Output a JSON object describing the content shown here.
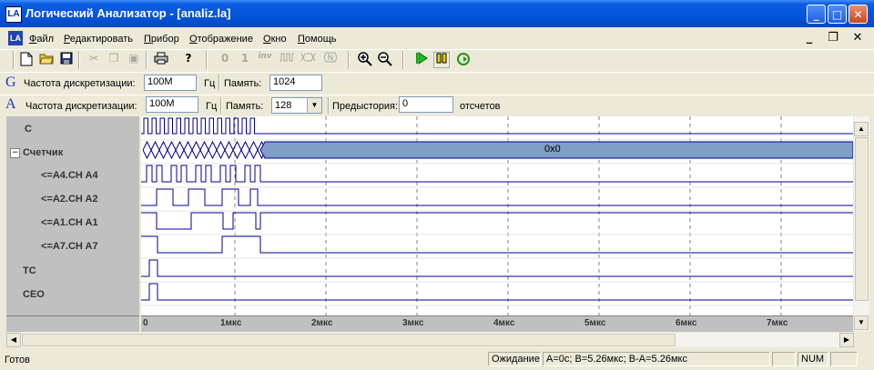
{
  "window": {
    "app_icon_text": "LA",
    "title": "Логический Анализатор - [analiz.la]",
    "minimize": "_",
    "maximize": "□",
    "close": "✕"
  },
  "menu": {
    "items": [
      "Файл",
      "Редактировать",
      "Прибор",
      "Отображение",
      "Окно",
      "Помощь"
    ],
    "mdi_minimize": "_",
    "mdi_restore": "❐",
    "mdi_close": "✕"
  },
  "toolbar": {
    "icons": [
      "new-document-icon",
      "open-folder-icon",
      "save-icon",
      "cut-icon",
      "copy-icon",
      "paste-icon",
      "print-icon",
      "help-icon",
      "zero-icon",
      "one-icon",
      "inv-icon",
      "clock-icon",
      "bus-icon",
      "number-icon",
      "zoom-in-icon",
      "zoom-out-icon",
      "run-icon",
      "pause-icon",
      "repeat-icon"
    ],
    "zero_label": "0",
    "one_label": "1",
    "inv_label": "inv"
  },
  "generator_bar": {
    "mode_letter": "G",
    "freq_label": "Частота дискретизации:",
    "freq_value": "100M",
    "freq_unit": "Гц",
    "mem_label": "Память:",
    "mem_value": "1024"
  },
  "analyzer_bar": {
    "mode_letter": "A",
    "freq_label": "Частота дискретизации:",
    "freq_value": "100M",
    "freq_unit": "Гц",
    "mem_label": "Память:",
    "mem_value": "128",
    "pre_label": "Предыстория:",
    "pre_value": "0",
    "pre_unit": "отсчетов"
  },
  "signals": [
    {
      "name": "C"
    },
    {
      "name": "Счетчик",
      "expander": "−"
    },
    {
      "name": "<=A4.CH A4"
    },
    {
      "name": "<=A2.CH A2"
    },
    {
      "name": "<=A1.CH A1"
    },
    {
      "name": "<=A7.CH A7"
    },
    {
      "name": "TC"
    },
    {
      "name": "CEO"
    }
  ],
  "bus_value": "0x0",
  "timeline": {
    "start": "0",
    "ticks": [
      "1мкс",
      "2мкс",
      "3мкс",
      "4мкс",
      "5мкс",
      "6мкс",
      "7мкс"
    ]
  },
  "colors": {
    "wave": "#00008b",
    "bus_fill": "#7f9fc8",
    "grid": "#808080"
  },
  "status": {
    "left": "Готов",
    "state": "Ожидание",
    "cursors": "A=0с; B=5.26мкс; B-A=5.26мкс",
    "num": "NUM"
  }
}
